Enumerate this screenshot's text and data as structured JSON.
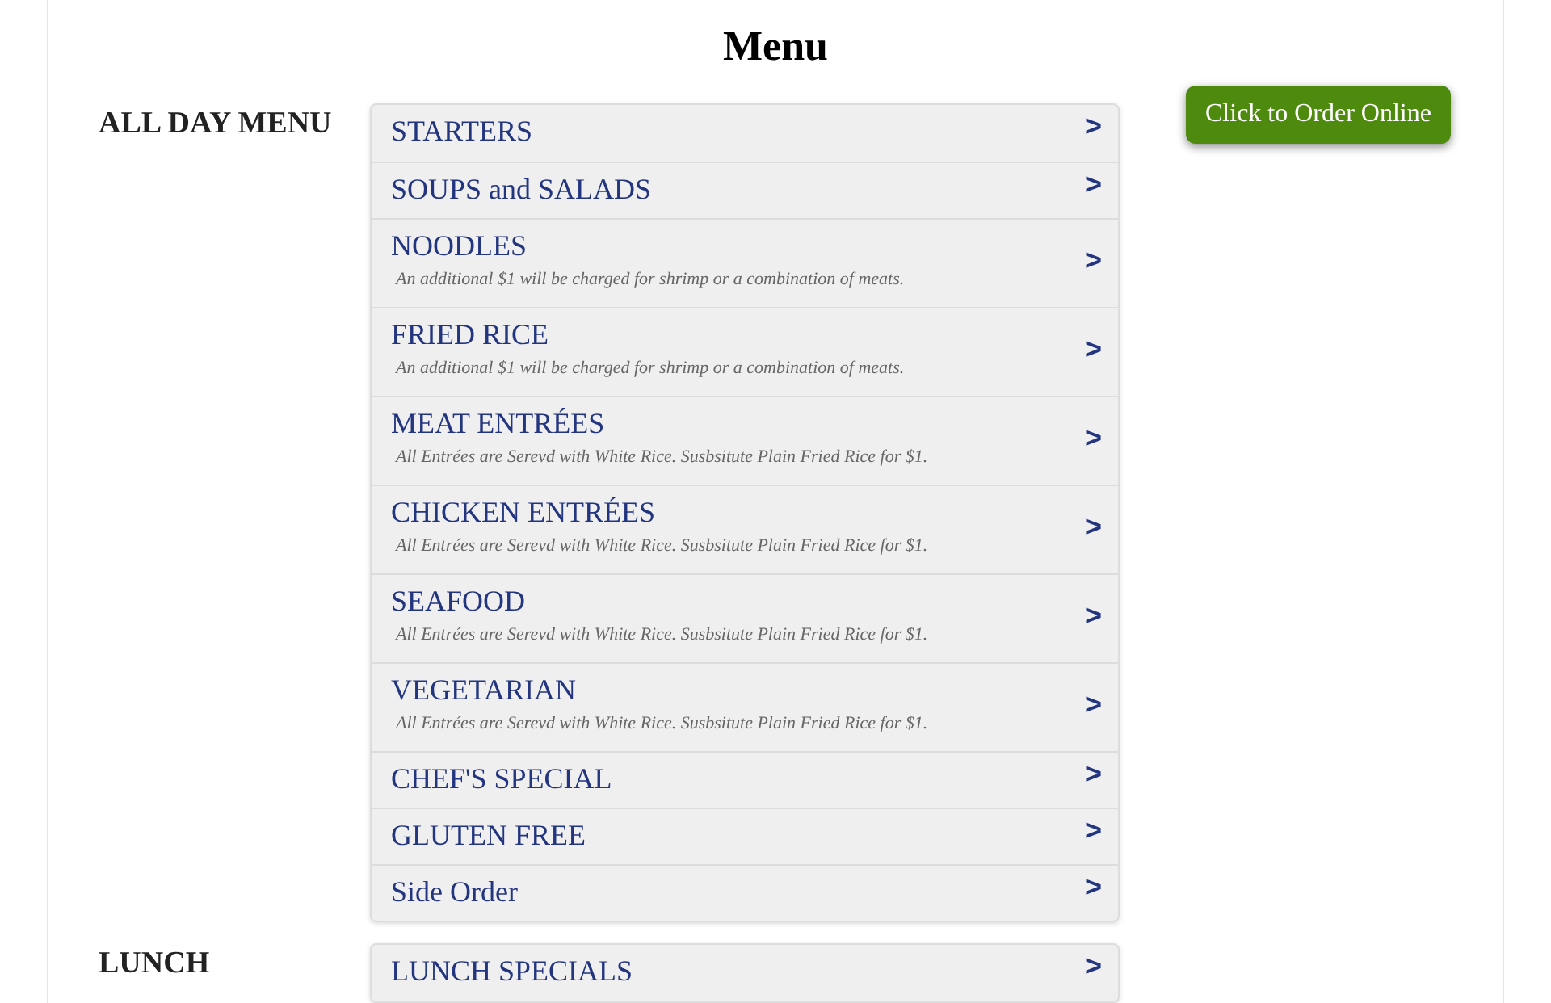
{
  "title": "Menu",
  "order_button": "Click to Order Online",
  "sections": [
    {
      "label": "ALL DAY MENU",
      "items": [
        {
          "name": "STARTERS",
          "chevron": ">"
        },
        {
          "name": "SOUPS and SALADS",
          "chevron": ">"
        },
        {
          "name": "NOODLES",
          "note": "An additional $1 will be charged for shrimp or a combination of meats.",
          "chevron": ">"
        },
        {
          "name": "FRIED RICE",
          "note": "An additional $1 will be charged for shrimp or a combination of meats.",
          "chevron": ">"
        },
        {
          "name": "MEAT ENTRÉES",
          "note": "All Entrées are Serevd with White Rice. Susbsitute Plain Fried Rice for $1.",
          "chevron": ">"
        },
        {
          "name": "CHICKEN ENTRÉES",
          "note": "All Entrées are Serevd with White Rice. Susbsitute Plain Fried Rice for $1.",
          "chevron": ">"
        },
        {
          "name": "SEAFOOD",
          "note": "All Entrées are Serevd with White Rice. Susbsitute Plain Fried Rice for $1.",
          "chevron": ">"
        },
        {
          "name": "VEGETARIAN",
          "note": "All Entrées are Serevd with White Rice. Susbsitute Plain Fried Rice for $1.",
          "chevron": ">"
        },
        {
          "name": "CHEF'S SPECIAL",
          "chevron": ">"
        },
        {
          "name": "GLUTEN FREE",
          "chevron": ">"
        },
        {
          "name": "Side Order",
          "chevron": ">"
        }
      ]
    },
    {
      "label": "LUNCH",
      "items": [
        {
          "name": "LUNCH SPECIALS",
          "chevron": ">"
        }
      ]
    }
  ]
}
